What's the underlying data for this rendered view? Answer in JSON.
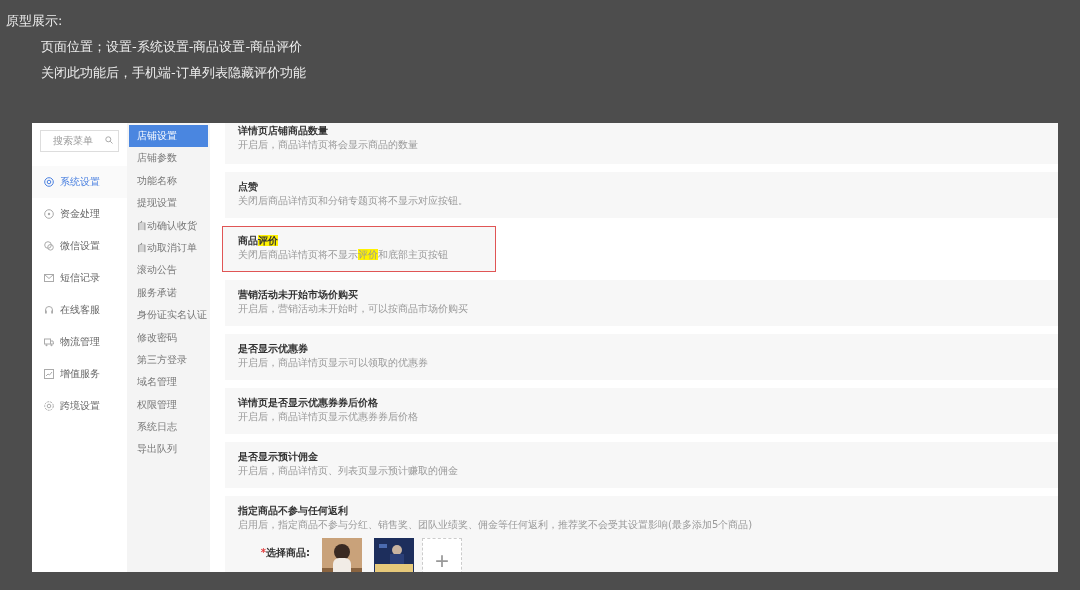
{
  "notes": {
    "heading": "原型展示:",
    "lines": [
      "页面位置；设置-系统设置-商品设置-商品评价",
      "关闭此功能后，手机端-订单列表隐藏评价功能"
    ]
  },
  "search": {
    "placeholder": "搜索菜单"
  },
  "sidebar": {
    "items": [
      {
        "label": "系统设置",
        "selected": true
      },
      {
        "label": "资金处理",
        "selected": false
      },
      {
        "label": "微信设置",
        "selected": false
      },
      {
        "label": "短信记录",
        "selected": false
      },
      {
        "label": "在线客服",
        "selected": false
      },
      {
        "label": "物流管理",
        "selected": false
      },
      {
        "label": "增值服务",
        "selected": false
      },
      {
        "label": "跨境设置",
        "selected": false
      }
    ]
  },
  "submenu": {
    "items": [
      {
        "label": "店铺设置",
        "selected": true
      },
      {
        "label": "店铺参数",
        "selected": false
      },
      {
        "label": "功能名称",
        "selected": false
      },
      {
        "label": "提现设置",
        "selected": false
      },
      {
        "label": "自动确认收货",
        "selected": false
      },
      {
        "label": "自动取消订单",
        "selected": false
      },
      {
        "label": "滚动公告",
        "selected": false
      },
      {
        "label": "服务承诺",
        "selected": false
      },
      {
        "label": "身份证实名认证",
        "selected": false
      },
      {
        "label": "修改密码",
        "selected": false
      },
      {
        "label": "第三方登录",
        "selected": false
      },
      {
        "label": "域名管理",
        "selected": false
      },
      {
        "label": "权限管理",
        "selected": false
      },
      {
        "label": "系统日志",
        "selected": false
      },
      {
        "label": "导出队列",
        "selected": false
      }
    ]
  },
  "settings": [
    {
      "outlined": false,
      "title": [
        {
          "text": "详情页店铺商品数量",
          "highlighted": false
        }
      ],
      "description": [
        {
          "text": "开启后，商品详情页将会显示商品的数量",
          "highlighted": false
        }
      ]
    },
    {
      "outlined": false,
      "title": [
        {
          "text": "点赞",
          "highlighted": false
        }
      ],
      "description": [
        {
          "text": "关闭后商品详情页和分销专题页将不显示对应按钮。",
          "highlighted": false
        }
      ]
    },
    {
      "outlined": true,
      "title": [
        {
          "text": "商品",
          "highlighted": false
        },
        {
          "text": "评价",
          "highlighted": true
        }
      ],
      "description": [
        {
          "text": "关闭后商品详情页将不显示",
          "highlighted": false
        },
        {
          "text": "评价",
          "highlighted": true
        },
        {
          "text": "和底部主页按钮",
          "highlighted": false
        }
      ]
    },
    {
      "outlined": false,
      "title": [
        {
          "text": "营销活动未开始市场价购买",
          "highlighted": false
        }
      ],
      "description": [
        {
          "text": "开启后，营销活动未开始时，可以按商品市场价购买",
          "highlighted": false
        }
      ]
    },
    {
      "outlined": false,
      "title": [
        {
          "text": "是否显示优惠券",
          "highlighted": false
        }
      ],
      "description": [
        {
          "text": "开启后，商品详情页显示可以领取的优惠券",
          "highlighted": false
        }
      ]
    },
    {
      "outlined": false,
      "title": [
        {
          "text": "详情页是否显示优惠券券后价格",
          "highlighted": false
        }
      ],
      "description": [
        {
          "text": "开启后，商品详情页显示优惠券券后价格",
          "highlighted": false
        }
      ]
    },
    {
      "outlined": false,
      "title": [
        {
          "text": "是否显示预计佣金",
          "highlighted": false
        }
      ],
      "description": [
        {
          "text": "开启后，商品详情页、列表页显示预计赚取的佣金",
          "highlighted": false
        }
      ]
    }
  ],
  "exclusion": {
    "title": "指定商品不参与任何返利",
    "description": "启用后，指定商品不参与分红、销售奖、团队业绩奖、佣金等任何返利，推荐奖不会受其设置影响(最多添加5个商品)",
    "required_mark": "*",
    "label": "选择商品:",
    "add_button": "+"
  }
}
